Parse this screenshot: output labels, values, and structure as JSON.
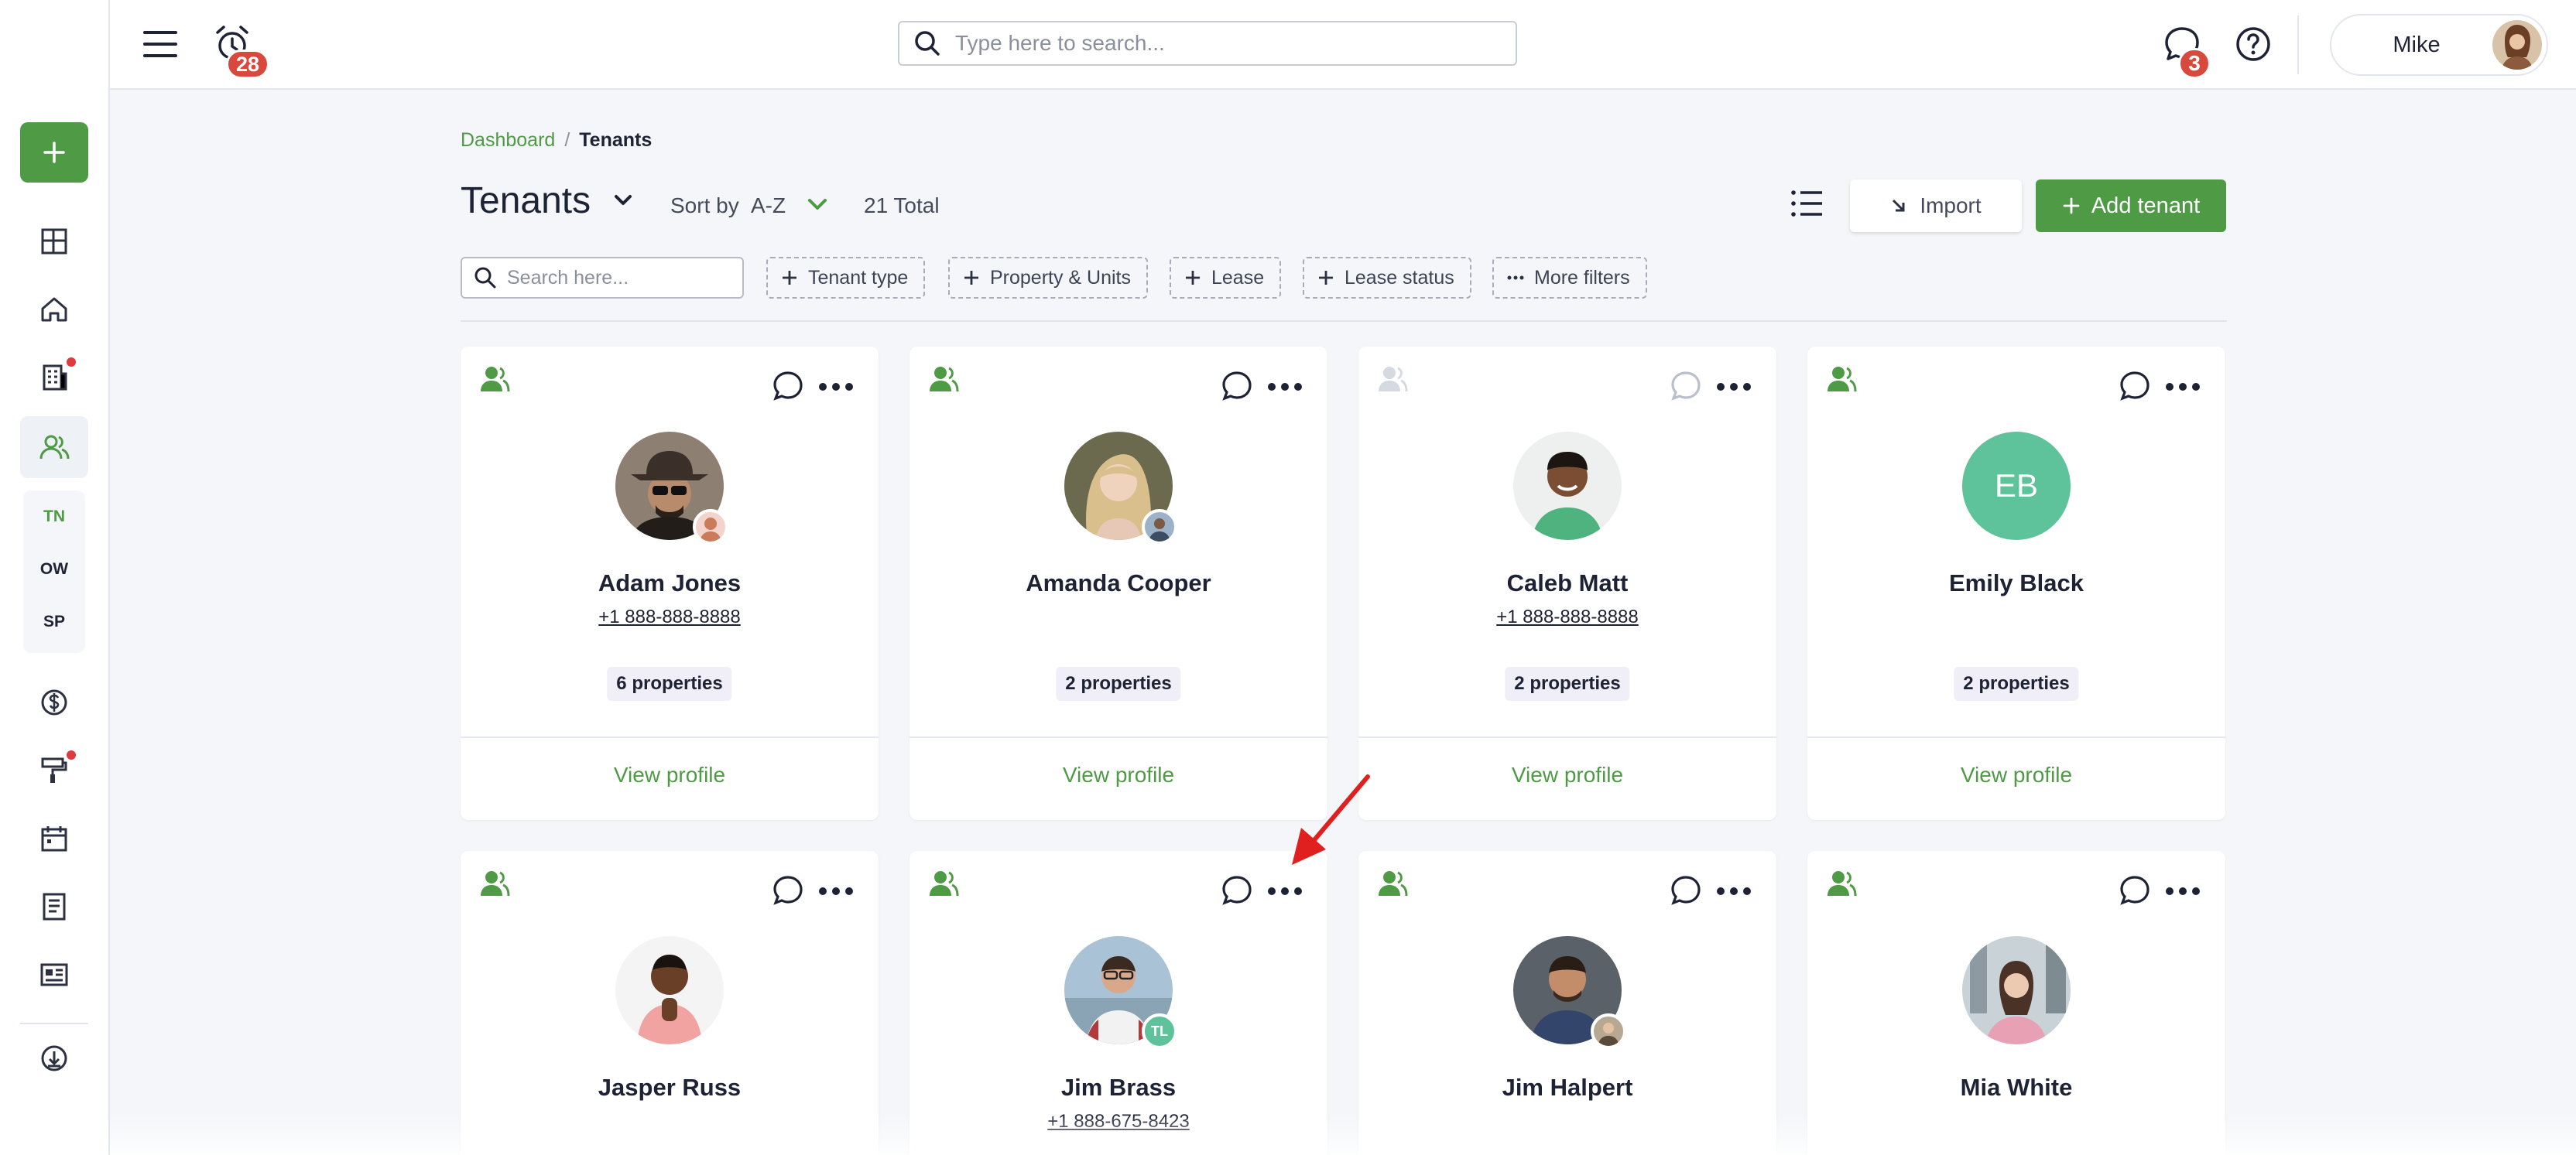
{
  "topbar": {
    "alarm_count": "28",
    "search_placeholder": "Type here to search...",
    "messages_count": "3",
    "user_name": "Mike"
  },
  "sidebar": {
    "sub_items": [
      "TN",
      "OW",
      "SP"
    ]
  },
  "breadcrumb": {
    "parent": "Dashboard",
    "separator": "/",
    "current": "Tenants"
  },
  "header": {
    "title": "Tenants",
    "sort_label": "Sort by",
    "sort_value": "A-Z",
    "total": "21 Total",
    "import_label": "Import",
    "add_label": "Add tenant"
  },
  "filters": {
    "search_placeholder": "Search here...",
    "chips": [
      "Tenant type",
      "Property & Units",
      "Lease",
      "Lease status",
      "More filters"
    ]
  },
  "cards": [
    {
      "name": "Adam Jones",
      "phone": "+1 888-888-8888",
      "properties": "6 properties",
      "view": "View profile"
    },
    {
      "name": "Amanda Cooper",
      "phone": "",
      "properties": "2 properties",
      "view": "View profile"
    },
    {
      "name": "Caleb Matt",
      "phone": "+1 888-888-8888",
      "properties": "2 properties",
      "view": "View profile"
    },
    {
      "name": "Emily Black",
      "initials": "EB",
      "phone": "",
      "properties": "2 properties",
      "view": "View profile"
    },
    {
      "name": "Jasper Russ",
      "phone": ""
    },
    {
      "name": "Jim Brass",
      "phone": "+1 888-675-8423",
      "mini_initials": "TL"
    },
    {
      "name": "Jim Halpert",
      "phone": ""
    },
    {
      "name": "Mia White",
      "phone": ""
    }
  ],
  "colors": {
    "accent": "#4e9a45",
    "badge": "#d9483d",
    "initials_avatar": "#5ec29a",
    "annotation_arrow": "#e0201e"
  }
}
